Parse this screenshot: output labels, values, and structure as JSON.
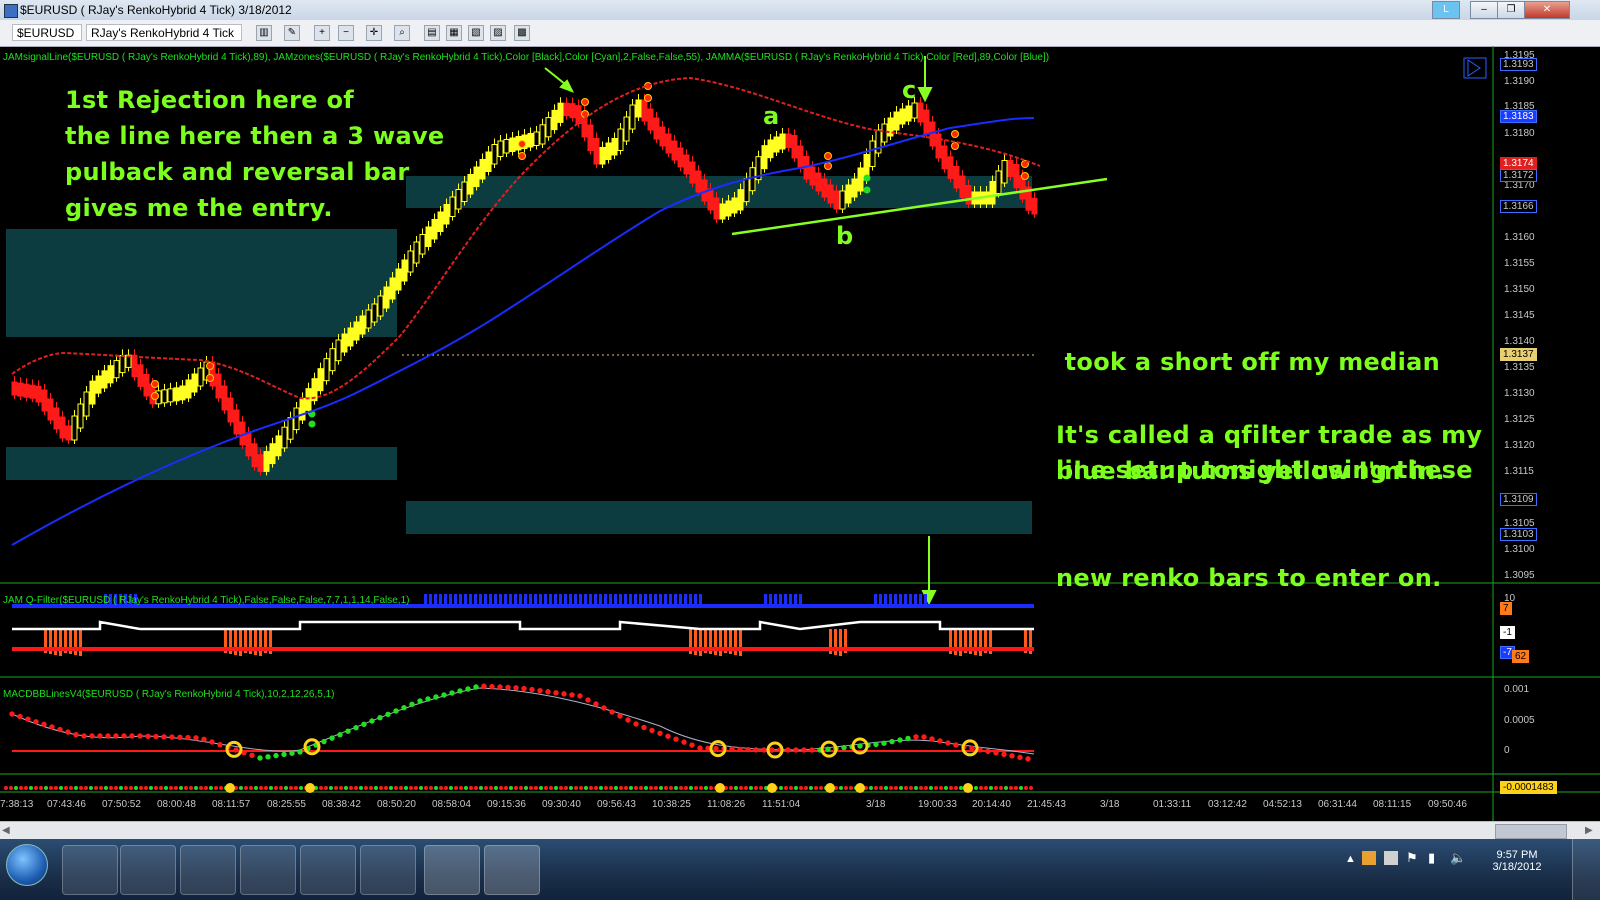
{
  "window": {
    "title": "$EURUSD ( RJay's RenkoHybrid  4 Tick)  3/18/2012",
    "tag_label": "L"
  },
  "toolbar": {
    "symbol": "$EURUSD",
    "bar_type": "RJay's RenkoHybrid  4 Tick"
  },
  "panels": {
    "price_study": "JAMsignalLine($EURUSD ( RJay's RenkoHybrid  4 Tick),89), JAMzones($EURUSD ( RJay's RenkoHybrid  4 Tick),Color [Black],Color [Cyan],2,False,False,55), JAMMA($EURUSD ( RJay's RenkoHybrid  4 Tick),Color [Red],89,Color [Blue])",
    "qfilter_study": "JAM Q-Filter($EURUSD ( RJay's RenkoHybrid  4 Tick),False,False,False,7,7,1,1,14,False,1)",
    "macd_study": "MACDBBLinesV4($EURUSD ( RJay's RenkoHybrid  4 Tick),10,2,12,26,5,1)"
  },
  "annotations": {
    "left": [
      "1st Rejection here of",
      "the line here then a 3 wave",
      "pulback and reversal bar",
      "gives me the entry."
    ],
    "right": [
      " took a short off my median",
      "line setup tonight using these",
      "new renko bars to enter on."
    ],
    "right2": [
      "It's called a qfilter trade as my",
      "blue bar turns yellow I'm in."
    ],
    "wave_a": "a",
    "wave_b": "b",
    "wave_c": "c"
  },
  "price_axis": {
    "labels": [
      "1.3195",
      "1.3190",
      "1.3185",
      "1.3180",
      "1.3170",
      "1.3160",
      "1.3155",
      "1.3150",
      "1.3145",
      "1.3140",
      "1.3135",
      "1.3130",
      "1.3125",
      "1.3120",
      "1.3115",
      "1.3105",
      "1.3100",
      "1.3095"
    ],
    "tags": [
      "1.3193",
      "1.3183",
      "1.3174",
      "1.3172",
      "1.3166",
      "1.3137",
      "1.3109",
      "1.3103"
    ]
  },
  "qfilter_axis": {
    "labels": [
      "10",
      "7",
      "-1",
      "-7",
      "62"
    ]
  },
  "macd_axis": {
    "labels": [
      "0.001",
      "0.0005",
      "0"
    ],
    "tag": "-0.0001483"
  },
  "time_axis": {
    "labels": [
      "7:38:13",
      "07:43:46",
      "07:50:52",
      "08:00:48",
      "08:11:57",
      "08:25:55",
      "08:38:42",
      "08:50:20",
      "08:58:04",
      "09:15:36",
      "09:30:40",
      "09:56:43",
      "10:38:25",
      "11:08:26",
      "11:51:04",
      "3/18",
      "19:00:33",
      "20:14:40",
      "21:45:43",
      "3/18",
      "01:33:11",
      "03:12:42",
      "04:52:13",
      "06:31:44",
      "08:11:15",
      "09:50:46"
    ]
  },
  "taskbar": {
    "clock_time": "9:57 PM",
    "clock_date": "3/18/2012"
  },
  "colors": {
    "up_bar": "#ffff22",
    "down_bar": "#ff1a1a",
    "signal_line": "#e02020",
    "ma_line": "#1a2cff",
    "zone": "#0c3c40",
    "trendline": "#88ff22",
    "annotation": "#7dff1e"
  }
}
